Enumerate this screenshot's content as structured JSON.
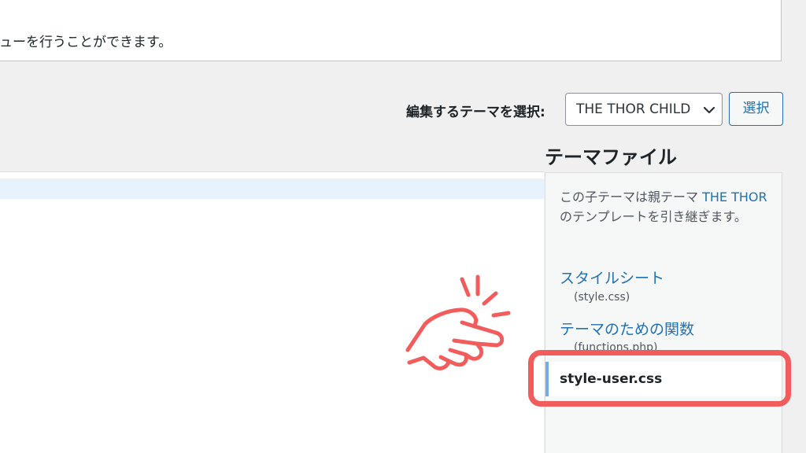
{
  "notice": {
    "text": "ューを行うことができます。"
  },
  "theme_select": {
    "label": "編集するテーマを選択:",
    "selected": "THE THOR CHILD",
    "button_label": "選択"
  },
  "sidebar": {
    "heading": "テーマファイル",
    "description_before": "この子テーマは親テーマ ",
    "parent_theme": "THE THOR",
    "description_after": " のテンプレートを引き継ぎます。",
    "files": [
      {
        "label": "スタイルシート",
        "filename": "(style.css)"
      },
      {
        "label": "テーマのための関数",
        "filename": "(functions.php)"
      }
    ],
    "selected_file": "style-user.css"
  },
  "colors": {
    "accent": "#2271b1",
    "annotation": "#f25c5c",
    "selected_bar": "#72aee6"
  },
  "icons": {
    "select_arrow": "chevron-down-icon",
    "annotation": "pointing-hand-icon"
  }
}
